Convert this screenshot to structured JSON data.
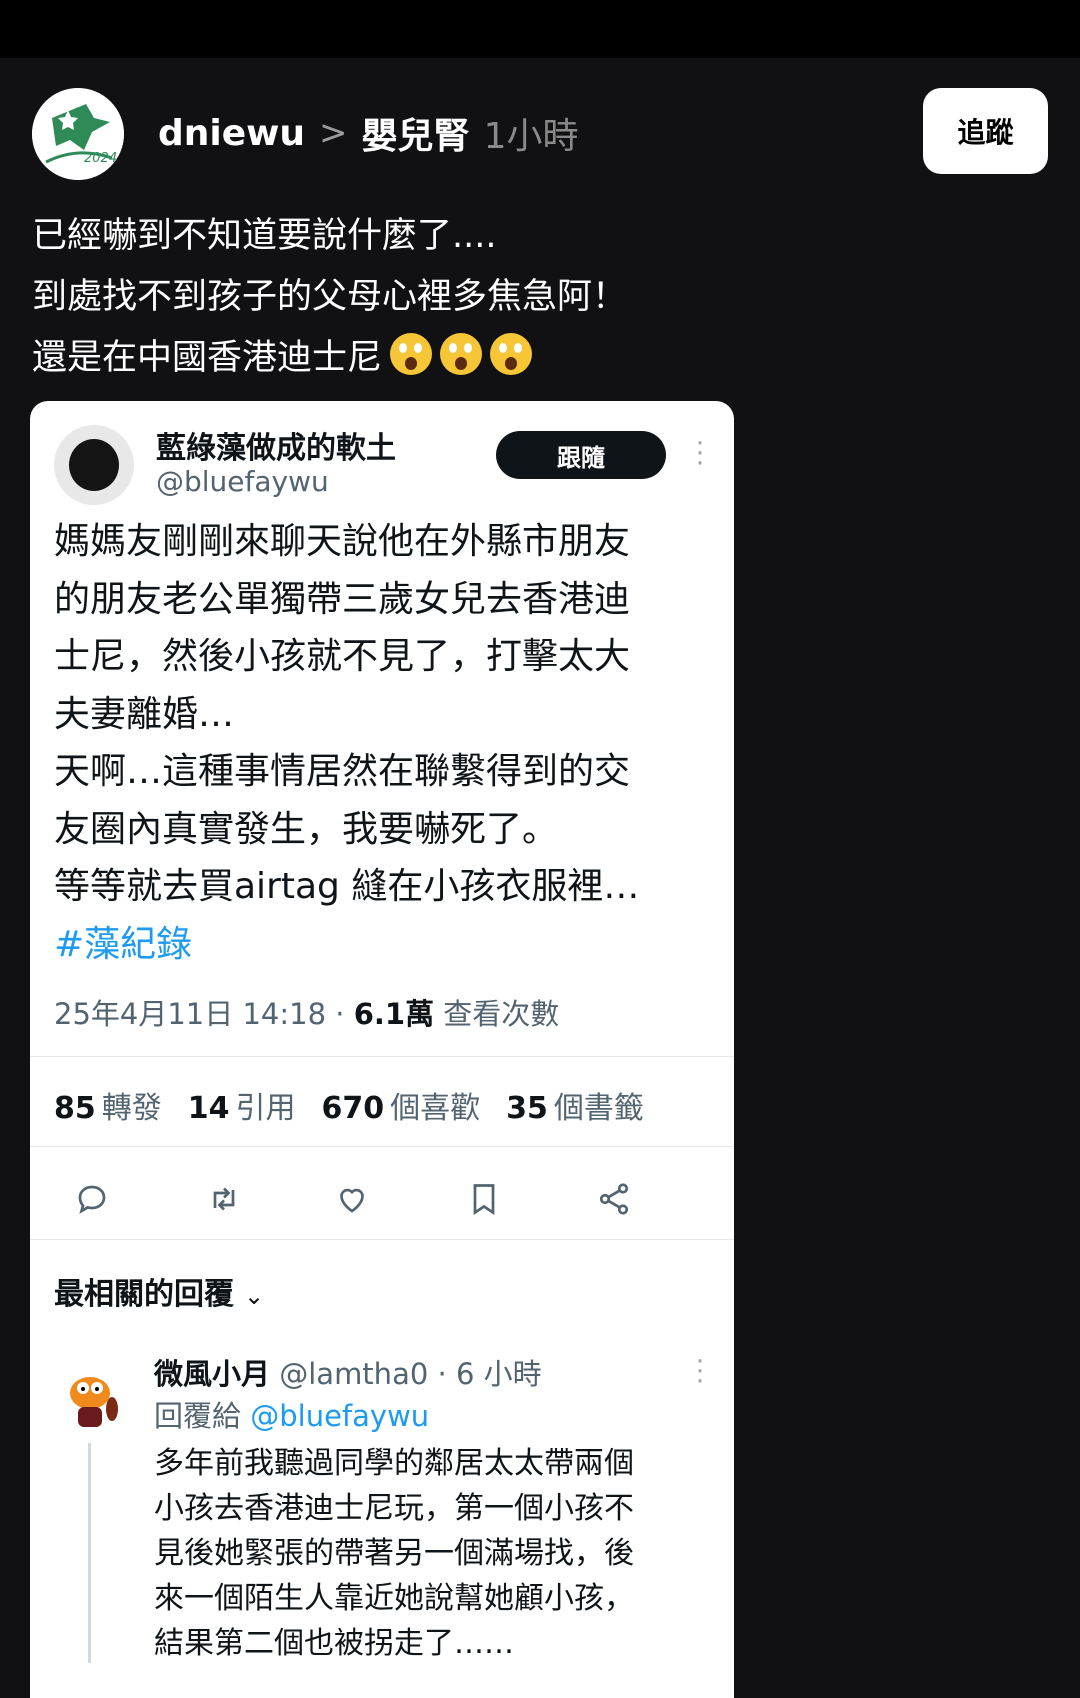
{
  "post": {
    "username": "dniewu",
    "separator": ">",
    "topic": "嬰兒腎",
    "time": "1小時",
    "follow_label": "追蹤",
    "avatar_text": "2024",
    "lines": [
      "已經嚇到不知道要說什麼了....",
      "到處找不到孩子的父母心裡多焦急阿！",
      "還是在中國香港迪士尼"
    ],
    "emoji_name": "face-screaming-in-fear"
  },
  "embedded": {
    "display_name": "藍綠藻做成的軟土",
    "handle": "@bluefaywu",
    "follow_label": "跟隨",
    "body_lines": [
      "媽媽友剛剛來聊天說他在外縣市朋友",
      "的朋友老公單獨帶三歲女兒去香港迪",
      "士尼，然後小孩就不見了，打擊太大",
      "夫妻離婚…",
      "天啊…這種事情居然在聯繫得到的交",
      "友圈內真實發生，我要嚇死了。",
      "等等就去買airtag 縫在小孩衣服裡…"
    ],
    "hashtag": "#藻紀錄",
    "timestamp": "25年4月11日 14:18",
    "dot": "·",
    "views": "6.1萬",
    "views_label": "查看次數",
    "stats": {
      "retweets": "85",
      "retweets_label": "轉發",
      "quotes": "14",
      "quotes_label": "引用",
      "likes": "670",
      "likes_label": "個喜歡",
      "bookmarks": "35",
      "bookmarks_label": "個書籤"
    },
    "actions": [
      "reply-icon",
      "retweet-icon",
      "like-icon",
      "bookmark-icon",
      "share-icon"
    ],
    "relevant_label": "最相關的回覆",
    "reply": {
      "display_name": "微風小月",
      "handle": "@lamtha0",
      "time": "· 6 小時",
      "reply_to_label": "回覆給",
      "reply_to_handle": "@bluefaywu",
      "body_lines": [
        "多年前我聽過同學的鄰居太太帶兩個",
        "小孩去香港迪士尼玩，第一個小孩不",
        "見後她緊張的帶著另一個滿場找，後",
        "來一個陌生人靠近她說幫她顧小孩，",
        "結果第二個也被拐走了……"
      ]
    }
  },
  "colors": {
    "background": "#111113",
    "link": "#1d9bf0",
    "secondary_text": "#536471"
  }
}
